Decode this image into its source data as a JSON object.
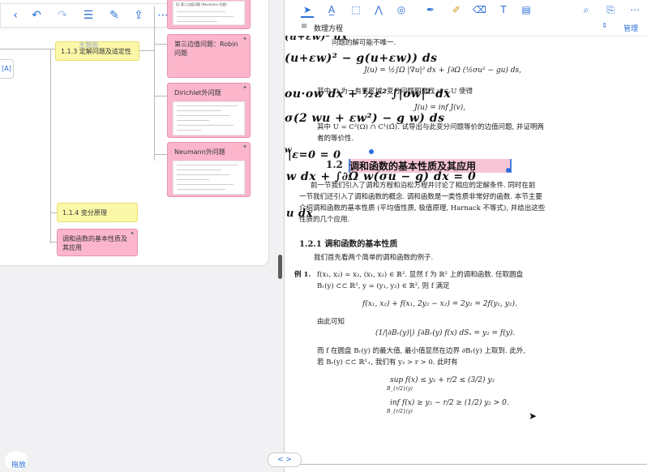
{
  "left": {
    "toolbar_icons": [
      "back-icon",
      "undo-icon",
      "redo-icon",
      "list-icon",
      "edit-icon",
      "share-icon",
      "more-icon"
    ],
    "top_node_snippet": "§2 第二边值问题 (Neumann 问题)",
    "nodes": {
      "n113": "1.1.3 定解问题及适定性",
      "n113_watermark": "主题图",
      "robin": "第三边值问题：Robin问题",
      "dirichlet": "Dirichlet外问题",
      "neumann": "Neumann外问题",
      "n114": "1.1.4 变分原理",
      "harmonic": "调和函数的基本性质及其应用"
    },
    "side_handle": "[A]",
    "drag_label": "拖放"
  },
  "right": {
    "toolbar_icons": [
      "select-icon",
      "text-icon",
      "crop-icon",
      "chart-icon",
      "shape-icon",
      "pen-icon",
      "highlighter-icon",
      "eraser-icon",
      "textbox-icon",
      "scan-icon",
      "search-icon",
      "bookmark-icon",
      "more-icon"
    ],
    "doc_title": "数理方程",
    "manage_label": "管理",
    "content": {
      "line_top": "问题的解可能不唯一.",
      "formula_J": "J(u) = ½∫Ω |∇u|² dx + ∫∂Ω (½σu² − gu) ds,",
      "text_where": "其中 Ω 为一有界区域. 变分问题即是找 u ∈ U 使得",
      "formula_min": "J(u) = inf J(v),",
      "text_U": "其中 U = C²(Ω) ∩ C¹(Ω̄). 试导出与此变分问题等价的边值问题, 并证明两",
      "text_U2": "者的等价性.",
      "section_num": "1.2",
      "section_title": "调和函数的基本性质及其应用",
      "intro1": "前一节我们引入了调和方程和泊松方程并讨论了相应的定解条件. 同时在前",
      "intro2": "一节我们还引入了调和函数的概念. 调和函数是一类性质非常好的函数. 本节主要",
      "intro3": "介绍调和函数的基本性质 (平均值性质, 极值原理, Harnack 不等式), 并给出这些",
      "intro4": "性质的几个应用.",
      "subsection": "1.2.1  调和函数的基本性质",
      "sub_intro": "我们首先看两个简单的调和函数的例子.",
      "example_label": "例 1.",
      "ex1": "f(x₁, x₂) = x₂, (x₁, x₂) ∈ ℝ². 显然 f 为 ℝ² 上的调和函数. 任取圆盘",
      "ex2": "Bᵣ(y) ⊂⊂ ℝ², y = (y₁, y₂) ∈ ℝ², 则 f 满足",
      "eq1": "f(x₁, x₂) + f(x₁, 2y₂ − x₂) = 2y₂ = 2f(y₁, y₂).",
      "yield": "由此可知",
      "eq2": "(1/|∂Bᵣ(y)|) ∫∂Bᵣ(y) f(x) dSₓ = y₂ = f(y).",
      "max1": "而 f 在圆盘 Bᵣ(y) 的最大值, 最小值显然在边界 ∂Bᵣ(y) 上取到. 此外,",
      "max2": "若 Bᵣ(y) ⊂⊂ ℝ²₊, 我们有 y₂ > r > 0. 此时有",
      "sup": "sup f(x) ≤ y₂ + r/2 ≤ (3/2) y₂",
      "sup_sub": "B_{r/2}(y)",
      "inf": "inf f(x) ≥ y₂ − r/2 ≥ (1/2) y₂ > 0.",
      "inf_sub": "B_{r/2}(y)"
    },
    "handwriting": [
      "(u+εw)² dx",
      "(u+εw)² − g(u+εw)) ds",
      "ou·ow dx + ½ε² ∫|ow|² dx",
      "σ(2  wu + εw²) − g  w) ds",
      "w",
      "|ε=0  = 0",
      "w dx + ∫∂Ω  w(σu − g) dx = 0",
      "u dx"
    ],
    "bottom_pill": "< >"
  }
}
